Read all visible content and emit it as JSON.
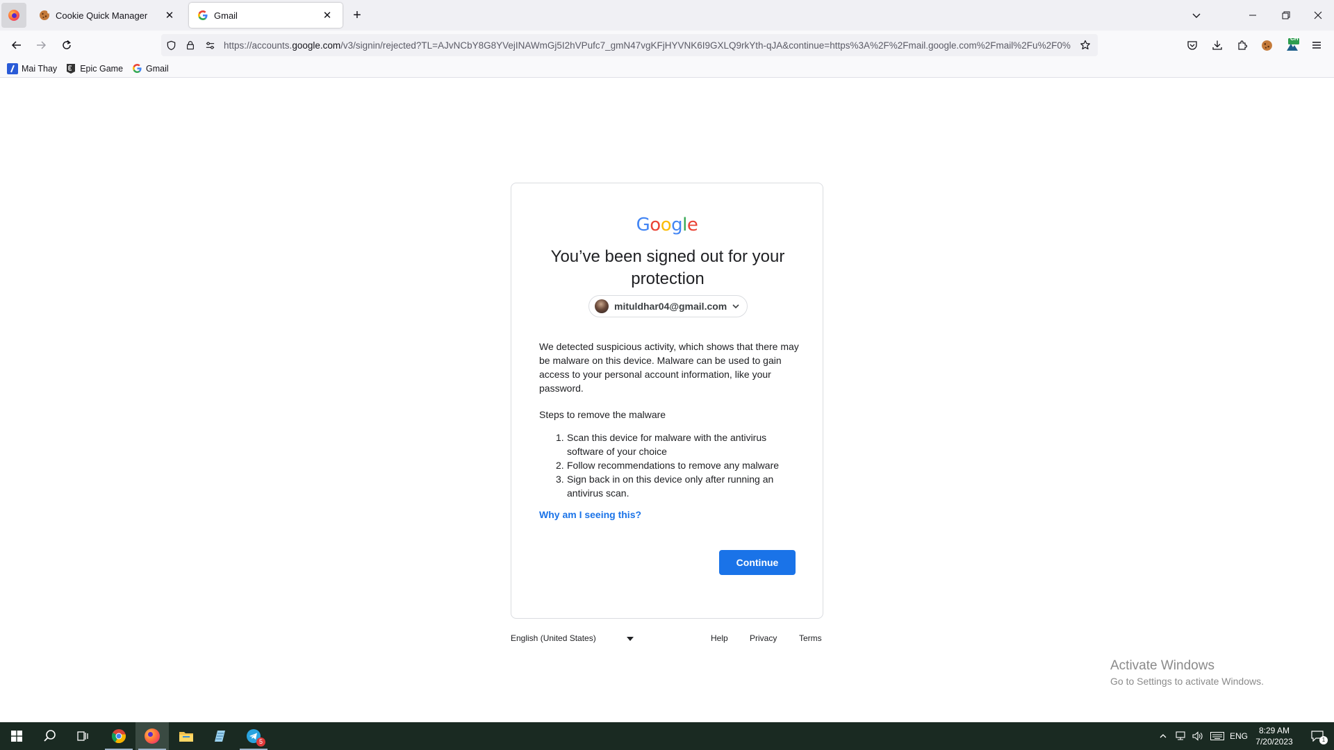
{
  "browser": {
    "tabs": [
      {
        "title": "Cookie Quick Manager",
        "active": false
      },
      {
        "title": "Gmail",
        "active": true
      }
    ],
    "url": {
      "prefix": "https://accounts.",
      "domain": "google.com",
      "path": "/v3/signin/rejected?TL=AJvNCbY8G8YVejINAWmGj5I2hVPufc7_gmN47vgKFjHYVNK6I9GXLQ9rkYth-qJA&continue=https%3A%2F%2Fmail.google.com%2Fmail%2Fu%2F0%"
    },
    "bookmarks": [
      {
        "label": "Mai Thay"
      },
      {
        "label": "Epic Game"
      },
      {
        "label": "Gmail"
      }
    ],
    "extension_badge": "CH"
  },
  "signin": {
    "logo": [
      "G",
      "o",
      "o",
      "g",
      "l",
      "e"
    ],
    "logo_colors": [
      "#4285F4",
      "#EA4335",
      "#FBBC05",
      "#4285F4",
      "#34A853",
      "#EA4335"
    ],
    "heading": "You’ve been signed out for your protection",
    "account_email": "mituldhar04@gmail.com",
    "message": "We detected suspicious activity, which shows that there may be malware on this device. Malware can be used to gain access to your personal account information, like your password.",
    "steps_title": "Steps to remove the malware",
    "steps": [
      {
        "num": "1.",
        "text": "Scan this device for malware with the antivirus software of your choice"
      },
      {
        "num": "2.",
        "text": "Follow recommendations to remove any malware"
      },
      {
        "num": "3.",
        "text": "Sign back in on this device only after running an antivirus scan."
      }
    ],
    "why_link": "Why am I seeing this?",
    "continue_label": "Continue",
    "accent_color": "#1a73e8"
  },
  "footer": {
    "language": "English (United States)",
    "help": "Help",
    "privacy": "Privacy",
    "terms": "Terms"
  },
  "watermark": {
    "title": "Activate Windows",
    "subtitle": "Go to Settings to activate Windows."
  },
  "taskbar": {
    "telegram_badge": "5",
    "language": "ENG",
    "time": "8:29 AM",
    "date": "7/20/2023",
    "notification_count": "1"
  }
}
